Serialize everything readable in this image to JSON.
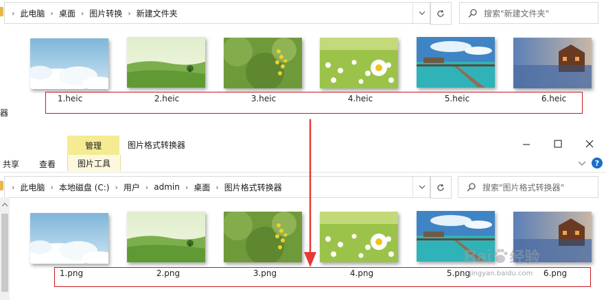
{
  "window1": {
    "breadcrumbs": [
      "此电脑",
      "桌面",
      "图片转换",
      "新建文件夹"
    ],
    "search_placeholder": "搜索\"新建文件夹\"",
    "left_fragment": "器",
    "files": [
      "1.heic",
      "2.heic",
      "3.heic",
      "4.heic",
      "5.heic",
      "6.heic"
    ]
  },
  "window2": {
    "title": "图片格式转换器",
    "ribbon": {
      "contextual_group": "管理",
      "contextual_tab": "图片工具",
      "tabs": [
        "共享",
        "查看"
      ]
    },
    "breadcrumbs": [
      "此电脑",
      "本地磁盘 (C:)",
      "用户",
      "admin",
      "桌面",
      "图片格式转换器"
    ],
    "search_placeholder": "搜索\"图片格式转换器\"",
    "files": [
      "1.png",
      "2.png",
      "3.png",
      "4.png",
      "5.png",
      "6.png"
    ]
  },
  "watermark": {
    "brand": "Bai",
    "brand_cn": "经验",
    "url": "jingyan.baidu.com"
  },
  "colors": {
    "highlight_box": "#c8161d",
    "arrow": "#e53935",
    "context_tab": "#f4eb92",
    "help_icon": "#1a6fc9"
  }
}
